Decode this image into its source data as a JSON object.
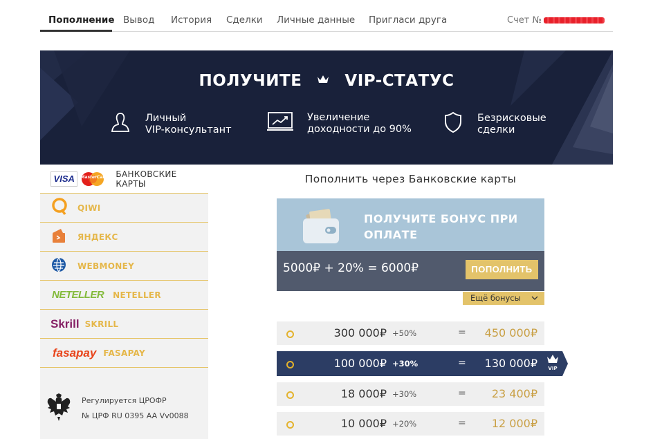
{
  "nav": {
    "tabs": [
      {
        "label": "Пополнение",
        "active": true
      },
      {
        "label": "Вывод"
      },
      {
        "label": "История"
      },
      {
        "label": "Сделки"
      },
      {
        "label": "Личные данные"
      },
      {
        "label": "Пригласи друга"
      }
    ],
    "account_label": "Счет №"
  },
  "banner": {
    "title_left": "ПОЛУЧИТЕ",
    "title_right": "VIP-СТАТУС",
    "crown_icon": "crown-icon",
    "features": [
      {
        "icon": "user-icon",
        "line1": "Личный",
        "line2": "VIP-консультант"
      },
      {
        "icon": "chart-icon",
        "line1": "Увеличение",
        "line2": "доходности до 90%"
      },
      {
        "icon": "shield-icon",
        "line1": "Безрисковые",
        "line2": "сделки"
      }
    ]
  },
  "methods": [
    {
      "label": "БАНКОВСКИЕ КАРТЫ",
      "logo_text": "VISA",
      "active": true
    },
    {
      "label": "QIWI"
    },
    {
      "label": "ЯНДЕКС"
    },
    {
      "label": "WEBMONEY"
    },
    {
      "label": "NETELLER",
      "logo_text": "NETELLER"
    },
    {
      "label": "SKRILL",
      "logo_text": "Skrill"
    },
    {
      "label": "FASAPAY",
      "logo_text": "fasapay"
    }
  ],
  "mastercard_text": "MasterCard",
  "regulator": {
    "line1": "Регулируется ЦРОФР",
    "line2": "№ ЦРФ RU 0395 AA Vv0088"
  },
  "content": {
    "title": "Пополнить через Банковские карты",
    "bonus_text_line1": "ПОЛУЧИТЕ БОНУС ПРИ",
    "bonus_text_line2": "ОПЛАТЕ",
    "formula": "5000₽ + 20% = 6000₽",
    "topup_button": "ПОПОЛНИТЬ",
    "more_bonuses": "Ещё бонусы"
  },
  "tiers": [
    {
      "amount": "300 000₽",
      "pct": "+50%",
      "eq": "=",
      "result": "450 000₽",
      "vip": false
    },
    {
      "amount": "100 000₽",
      "pct": "+30%",
      "eq": "=",
      "result": "130 000₽",
      "vip": true,
      "badge": "VIP"
    },
    {
      "amount": "18 000₽",
      "pct": "+30%",
      "eq": "=",
      "result": "23 400₽",
      "vip": false
    },
    {
      "amount": "10 000₽",
      "pct": "+20%",
      "eq": "=",
      "result": "12 000₽",
      "vip": false
    }
  ],
  "colors": {
    "banner_bg": "#19213a",
    "accent_gold": "#e3c36a",
    "vip_row": "#2c3d64",
    "bonus_top": "#a9c5d8",
    "bonus_bottom": "#515a6d"
  }
}
